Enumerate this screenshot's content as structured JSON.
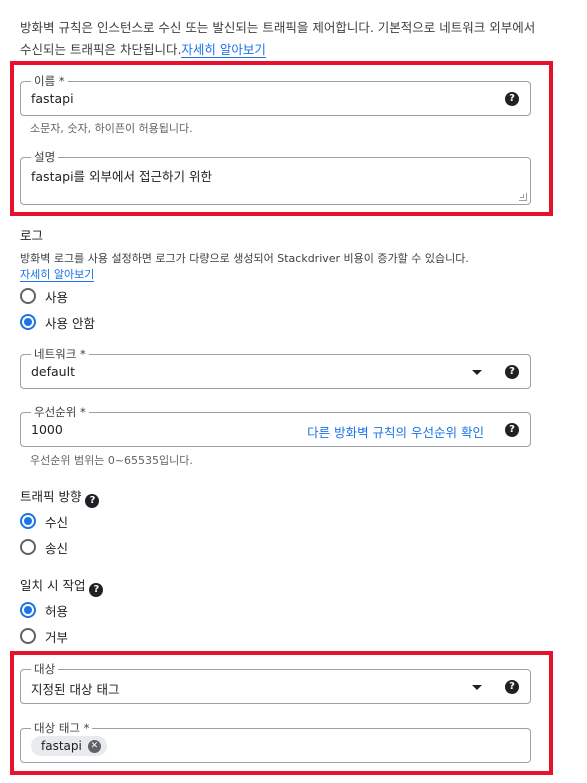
{
  "intro": {
    "text": "방화벽 규칙은 인스턴스로 수신 또는 발신되는 트래픽을 제어합니다. 기본적으로 네트워크 외부에서 수신되는 트래픽은 차단됩니다.",
    "link": "자세히 알아보기"
  },
  "name_field": {
    "label": "이름 *",
    "value": "fastapi",
    "hint": "소문자, 숫자, 하이픈이 허용됩니다.",
    "help_icon": "?"
  },
  "description_field": {
    "label": "설명",
    "value": "fastapi를 외부에서 접근하기 위한"
  },
  "logs": {
    "title": "로그",
    "description": "방화벽 로그를 사용 설정하면 로그가 다량으로 생성되어 Stackdriver 비용이 증가할 수 있습니다.",
    "link": "자세히 알아보기",
    "options": [
      "사용",
      "사용 안함"
    ],
    "selected": "사용 안함"
  },
  "network_field": {
    "label": "네트워크 *",
    "value": "default",
    "help_icon": "?"
  },
  "priority_field": {
    "label": "우선순위 *",
    "value": "1000",
    "link": "다른 방화벽 규칙의 우선순위 확인",
    "hint": "우선순위 범위는 0~65535입니다.",
    "help_icon": "?"
  },
  "traffic_direction": {
    "title": "트래픽 방향",
    "help_icon": "?",
    "options": [
      "수신",
      "송신"
    ],
    "selected": "수신"
  },
  "action_on_match": {
    "title": "일치 시 작업",
    "help_icon": "?",
    "options": [
      "허용",
      "거부"
    ],
    "selected": "허용"
  },
  "targets_field": {
    "label": "대상",
    "value": "지정된 대상 태그",
    "help_icon": "?"
  },
  "target_tags_field": {
    "label": "대상 태그 *",
    "chips": [
      "fastapi"
    ],
    "chip_close": "✕"
  },
  "colors": {
    "highlight": "#e8112d",
    "accent": "#1a73e8"
  }
}
